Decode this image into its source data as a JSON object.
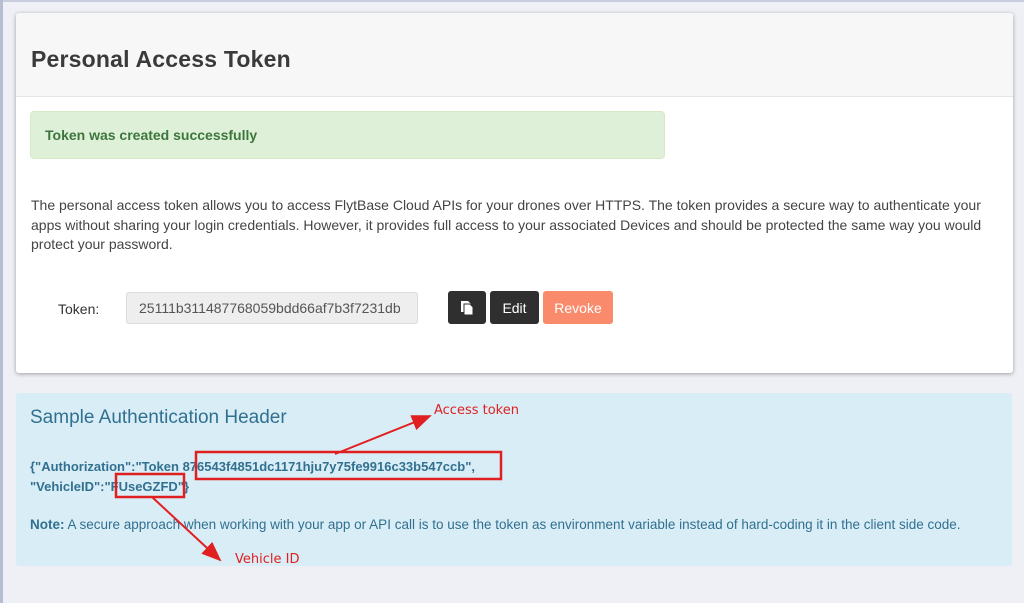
{
  "card": {
    "title": "Personal Access Token",
    "alert": "Token was created successfully",
    "description": "The personal access token allows you to access FlytBase Cloud APIs for your drones over HTTPS. The token provides a secure way to authenticate your apps without sharing your login credentials. However, it provides full access to your associated Devices and should be protected the same way you would protect your password.",
    "token_label": "Token:",
    "token_value": "25111b311487768059bdd66af7b3f7231db",
    "edit_label": "Edit",
    "revoke_label": "Revoke",
    "copy_icon": "copy-icon"
  },
  "sample": {
    "title": "Sample Authentication Header",
    "line1_prefix": "{\"Authorization\":\"Token ",
    "line1_token": "876543f4851dc1171hju7y75fe9916c33b547ccb",
    "line1_suffix": "\",",
    "line2_prefix": "\"VehicleID\":\"",
    "line2_id": "FUseGZFD",
    "line2_suffix": "\"}",
    "note_label": "Note:",
    "note_text": " A secure approach when working with your app or API call is to use the token as environment variable instead of hard-coding it in the client side code."
  },
  "annotations": {
    "access_token": "Access token",
    "vehicle_id": "Vehicle ID",
    "color": "#e02020"
  },
  "colors": {
    "alert_bg": "#dff0d8",
    "alert_text": "#3c763d",
    "info_bg": "#d9edf7",
    "info_text": "#31708f",
    "revoke_bg": "#f98b6c",
    "dark_button": "#2f2f2f"
  }
}
